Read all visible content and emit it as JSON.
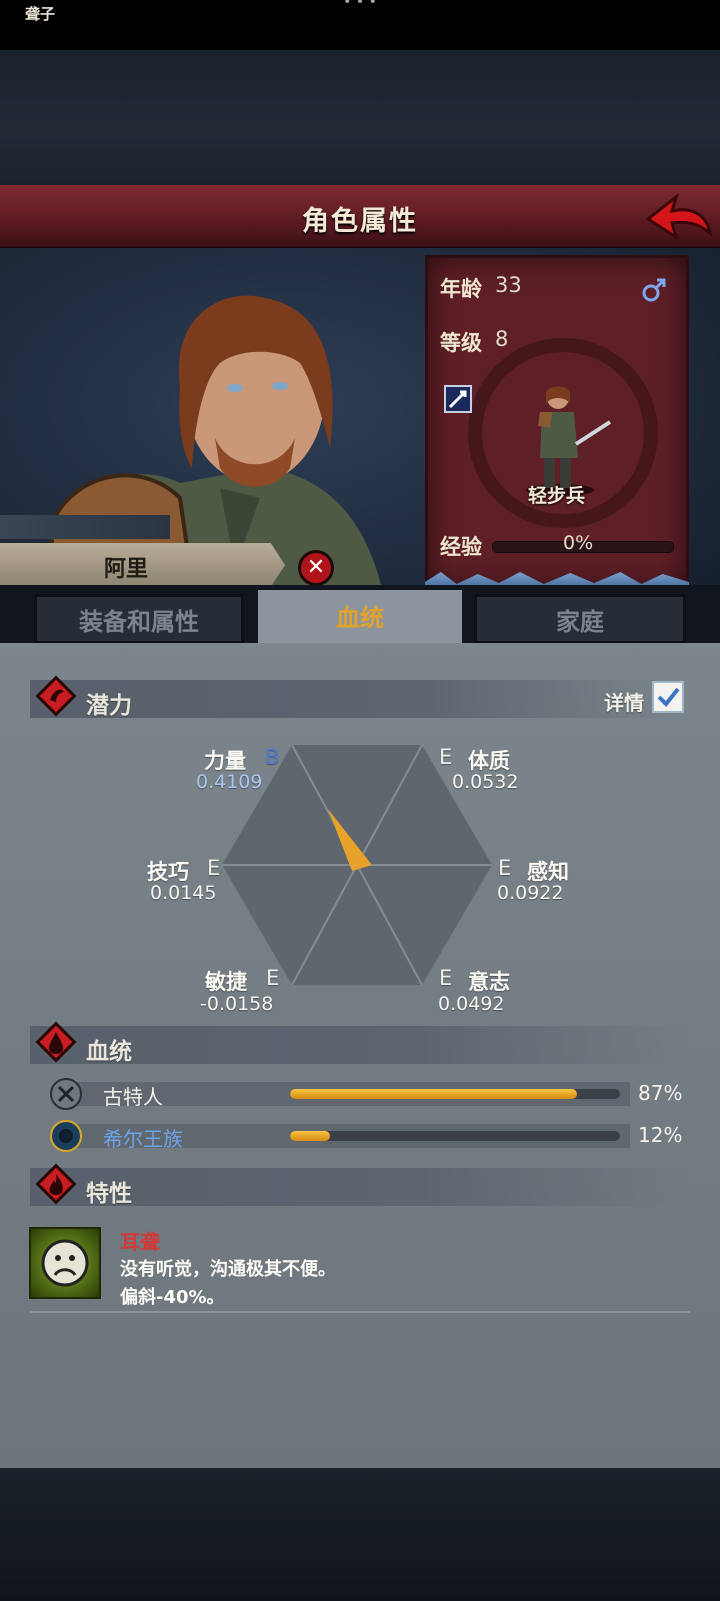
{
  "header": {
    "title": "角色属性"
  },
  "character": {
    "title_tag": "聋子",
    "name": "阿里",
    "age_label": "年龄",
    "age": "33",
    "level_label": "等级",
    "level": "8",
    "unit_type": "轻步兵",
    "xp_label": "经验",
    "xp_value": "0%"
  },
  "tabs": [
    {
      "label": "装备和属性"
    },
    {
      "label": "血统"
    },
    {
      "label": "家庭"
    }
  ],
  "potential": {
    "title": "潜力",
    "details_label": "详情",
    "stats": [
      {
        "name": "力量",
        "grade": "B",
        "value": "0.4109"
      },
      {
        "name": "体质",
        "grade": "E",
        "value": "0.0532"
      },
      {
        "name": "技巧",
        "grade": "E",
        "value": "0.0145"
      },
      {
        "name": "感知",
        "grade": "E",
        "value": "0.0922"
      },
      {
        "name": "敏捷",
        "grade": "E",
        "value": "-0.0158"
      },
      {
        "name": "意志",
        "grade": "E",
        "value": "0.0492"
      }
    ]
  },
  "lineage": {
    "title": "血统",
    "items": [
      {
        "name": "古特人",
        "percent_text": "87%",
        "fraction": 0.87,
        "icon": "crossed-axes-icon"
      },
      {
        "name": "希尔王族",
        "percent_text": "12%",
        "fraction": 0.12,
        "icon": "royal-crest-icon"
      }
    ]
  },
  "traits": {
    "title": "特性",
    "items": [
      {
        "name": "耳聋",
        "description": "没有听觉，沟通极其不便。",
        "effect": "偏斜-40%。",
        "icon": "sad-face-icon"
      }
    ]
  },
  "colors": {
    "accent": "#e2a32c",
    "header": "#6e2228",
    "panel": "#5e1f26",
    "trait_name": "#d13a3a"
  }
}
